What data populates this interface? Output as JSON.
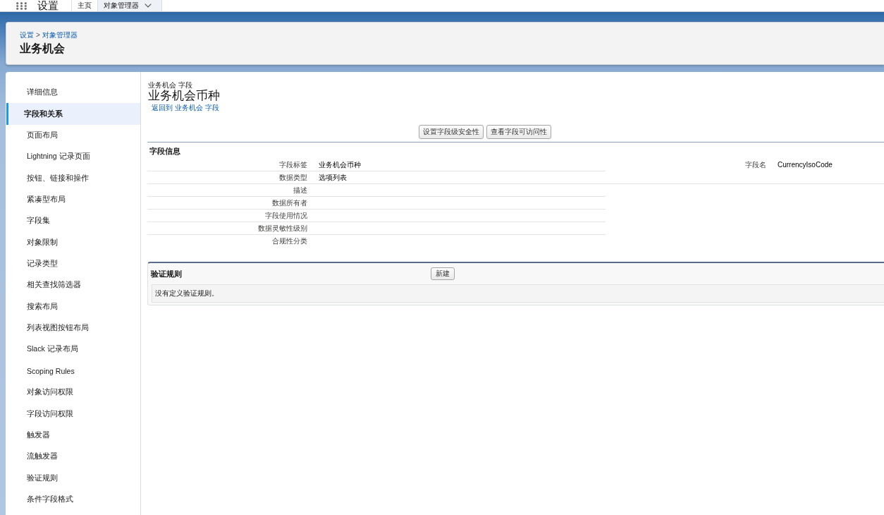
{
  "top_bar": {
    "app_name": "设置",
    "tabs": [
      {
        "label": "主页",
        "selected": false,
        "dropdown": false
      },
      {
        "label": "对象管理器",
        "selected": true,
        "dropdown": true
      }
    ]
  },
  "header": {
    "breadcrumb": {
      "items": [
        "设置",
        "对象管理器"
      ],
      "separator": ">"
    },
    "title": "业务机会"
  },
  "sidebar": {
    "items": [
      {
        "label": "详细信息",
        "selected": false
      },
      {
        "label": "字段和关系",
        "selected": true
      },
      {
        "label": "页面布局",
        "selected": false
      },
      {
        "label": "Lightning 记录页面",
        "selected": false
      },
      {
        "label": "按钮、链接和操作",
        "selected": false
      },
      {
        "label": "紧凑型布局",
        "selected": false
      },
      {
        "label": "字段集",
        "selected": false
      },
      {
        "label": "对象限制",
        "selected": false
      },
      {
        "label": "记录类型",
        "selected": false
      },
      {
        "label": "相关查找筛选器",
        "selected": false
      },
      {
        "label": "搜索布局",
        "selected": false
      },
      {
        "label": "列表视图按钮布局",
        "selected": false
      },
      {
        "label": "Slack 记录布局",
        "selected": false
      },
      {
        "label": "Scoping Rules",
        "selected": false
      },
      {
        "label": "对象访问权限",
        "selected": false
      },
      {
        "label": "字段访问权限",
        "selected": false
      },
      {
        "label": "触发器",
        "selected": false
      },
      {
        "label": "流触发器",
        "selected": false
      },
      {
        "label": "验证规则",
        "selected": false
      },
      {
        "label": "条件字段格式",
        "selected": false
      }
    ]
  },
  "content": {
    "subtitle": "业务机会 字段",
    "title": "业务机会币种",
    "back_link": "返回到 业务机会 字段",
    "buttons": [
      "设置字段级安全性",
      "查看字段可访问性"
    ],
    "field_info": {
      "title": "字段信息",
      "fields": [
        {
          "label": "字段标签",
          "value": "业务机会币种"
        },
        {
          "label": "数据类型",
          "value": "选项列表"
        },
        {
          "label": "描述"
        },
        {
          "label": "数据所有者"
        },
        {
          "label": "字段使用情况"
        },
        {
          "label": "数据灵敏性级别"
        },
        {
          "label": "合规性分类"
        }
      ],
      "side_fields": [
        {
          "label": "字段名",
          "value": "CurrencyIsoCode"
        }
      ]
    },
    "validation_rules": {
      "title": "验证规则",
      "new_button": "新建",
      "empty_message": "没有定义验证规则。"
    }
  }
}
